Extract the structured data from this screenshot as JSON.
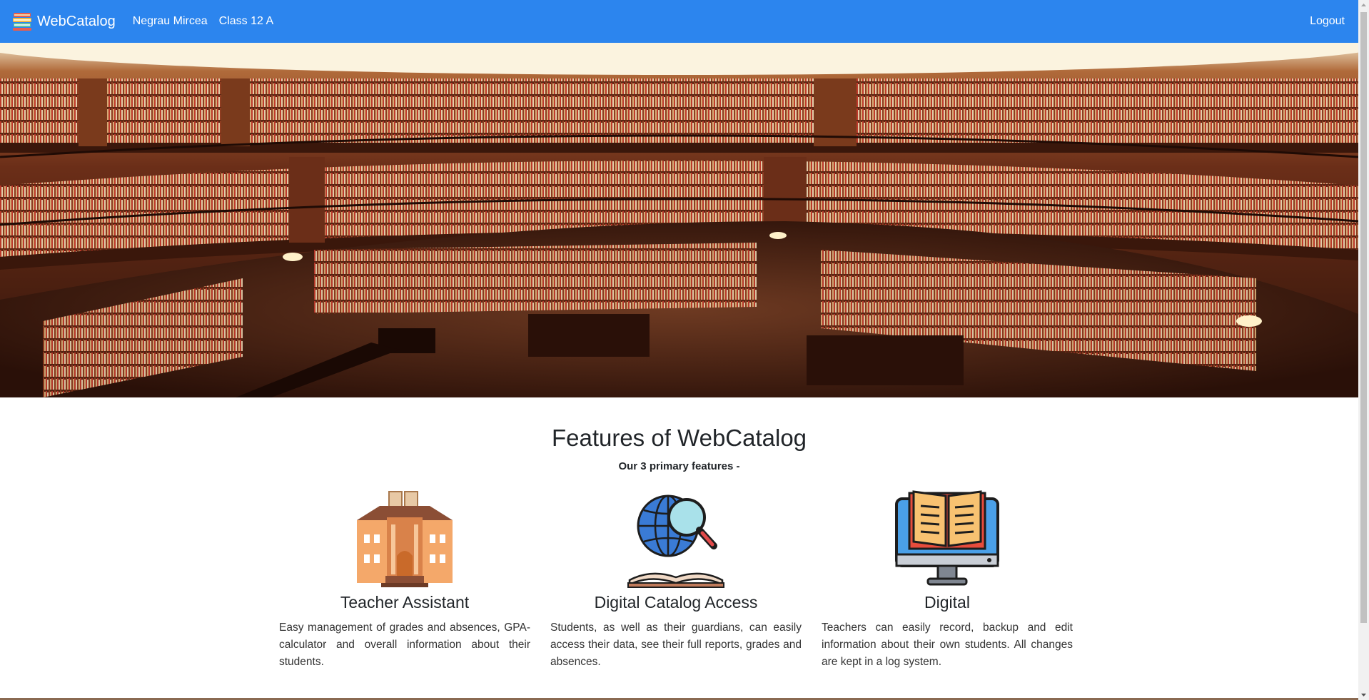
{
  "navbar": {
    "brand": "WebCatalog",
    "user_name": "Negrau Mircea",
    "class_label": "Class 12 A",
    "logout_label": "Logout",
    "bg_color": "#2c85ee"
  },
  "hero": {
    "image": "library-interior"
  },
  "features": {
    "title": "Features of WebCatalog",
    "subtitle": "Our 3 primary features -",
    "cards": [
      {
        "icon": "school-building-icon",
        "title": "Teacher Assistant",
        "text": "Easy management of grades and absences, GPA-calculator and overall information about their students."
      },
      {
        "icon": "globe-magnifier-book-icon",
        "title": "Digital Catalog Access",
        "text": "Students, as well as their guardians, can easily access their data, see their full reports, grades and absences."
      },
      {
        "icon": "monitor-book-icon",
        "title": "Digital",
        "text": "Teachers can easily record, backup and edit information about their own students. All changes are kept in a log system."
      }
    ]
  }
}
